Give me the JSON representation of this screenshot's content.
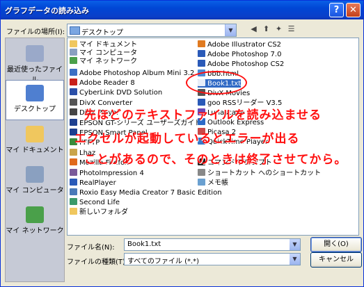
{
  "window": {
    "title": "グラフデータの読み込み",
    "help_label": "?",
    "close_label": "✕"
  },
  "lookin": {
    "label": "ファイルの場所(I):",
    "value": "デスクトップ"
  },
  "toolbar": {
    "back": "◀",
    "up": "⬆",
    "newfolder": "✦",
    "views": "☰"
  },
  "places": [
    {
      "label": "最近使ったファイル",
      "color": "#9aa9c9"
    },
    {
      "label": "デスクトップ",
      "color": "#4f7fd0"
    },
    {
      "label": "マイ ドキュメント",
      "color": "#f0c75e"
    },
    {
      "label": "マイ コンピュータ",
      "color": "#8aa0c0"
    },
    {
      "label": "マイ ネットワーク",
      "color": "#4aa04a"
    }
  ],
  "files_col1": [
    "マイ ドキュメント",
    "マイ コンピュータ",
    "マイ ネットワーク",
    "Adobe Photoshop Album Mini 3.2",
    "Adobe Reader 8",
    "CyberLink DVD Solution",
    "DivX Converter",
    "DivX Player",
    "EPSON GT-シリーズ ユーザーズガイド",
    "EPSON Smart Panel",
    "FFFTP",
    "Lhaz",
    "Mozilla Firefox",
    "PhotoImpression 4",
    "RealPlayer",
    "Roxio Easy Media Creator 7 Basic Edition",
    "Second Life",
    "新しいフォルダ"
  ],
  "files_col2": [
    "Adobe Illustrator CS2",
    "Adobe Photoshop 7.0",
    "Adobe Photoshop CS2",
    "bbb.html",
    "Book1.txt",
    "DivX Movies",
    "goo RSSリーダー V3.5",
    "Lunascape",
    "Outlook Express",
    "Picasa 2",
    "QuickTime Player",
    "コマンド プロンプト",
    "ショートカット へのショートカット",
    "メモ帳"
  ],
  "annotation": {
    "line1": "先ほどのテキストファイルを読み込ませる",
    "line2": "エクセルが起動しているとエラーが出る",
    "line3": "ことがあるので、そのときは終了させてから。"
  },
  "filename": {
    "label": "ファイル名(N):",
    "value": "Book1.txt"
  },
  "filetype": {
    "label": "ファイルの種類(T):",
    "value": "すべてのファイル (*.*)"
  },
  "buttons": {
    "open": "開く(O)",
    "cancel": "キャンセル"
  },
  "colors": {
    "annotation": "#ff1010",
    "titlebar": "#0a5fe6"
  }
}
